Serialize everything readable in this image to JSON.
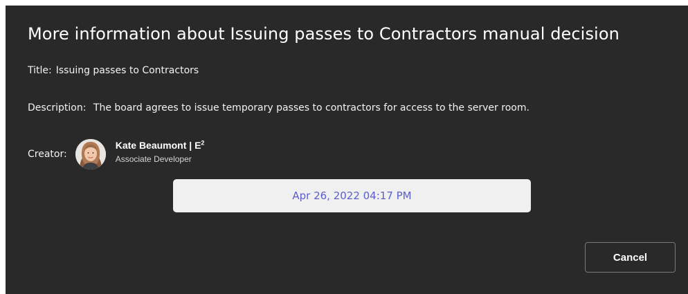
{
  "dialog": {
    "title": "More information about Issuing passes to Contractors manual decision",
    "title_line": {
      "label": "Title:",
      "value": "Issuing passes to Contractors"
    },
    "description_line": {
      "label": "Description:",
      "value": "The board agrees to issue temporary passes to contractors for access to the server room."
    },
    "creator": {
      "label": "Creator:",
      "name": "Kate Beaumont | E",
      "name_superscript": "2",
      "role": "Associate Developer"
    },
    "date_button": "Apr 26, 2022 04:17 PM",
    "cancel_button": "Cancel"
  },
  "colors": {
    "dialog_background": "#292929",
    "date_text": "#5b5fc7",
    "date_background": "#f0f0f0"
  },
  "icons": {
    "avatar": "user-avatar-photo"
  }
}
